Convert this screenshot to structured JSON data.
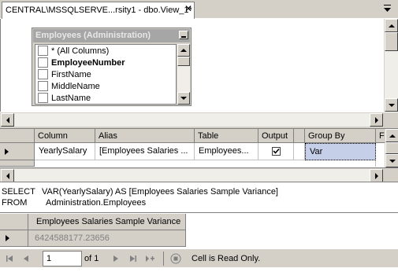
{
  "tab": {
    "title": "CENTRAL\\MSSQLSERVE...rsity1 - dbo.View_1*",
    "close_glyph": "✕"
  },
  "table_box": {
    "title": "Employees (Administration)",
    "columns": [
      {
        "label": "* (All Columns)",
        "bold": false,
        "checked": false
      },
      {
        "label": "EmployeeNumber",
        "bold": true,
        "checked": false
      },
      {
        "label": "FirstName",
        "bold": false,
        "checked": false
      },
      {
        "label": "MiddleName",
        "bold": false,
        "checked": false
      },
      {
        "label": "LastName",
        "bold": false,
        "checked": false
      }
    ]
  },
  "criteria_grid": {
    "headers": {
      "column": "Column",
      "alias": "Alias",
      "table": "Table",
      "output": "Output",
      "group_by": "Group By",
      "filter": "F"
    },
    "row": {
      "column": "YearlySalary",
      "alias": "[Employees Salaries ...",
      "table": "Employees...",
      "output_checked": true,
      "group_by": "Var"
    }
  },
  "sql": {
    "line1_kw": "SELECT",
    "line1_text": "VAR(YearlySalary) AS [Employees Salaries Sample Variance]",
    "line2_kw": "FROM",
    "line2_text": "Administration.Employees"
  },
  "results": {
    "header": "Employees Salaries Sample Variance",
    "value": "6424588177.23656"
  },
  "navigator": {
    "current_page": "1",
    "of_text": "of 1",
    "status": "Cell is Read Only."
  },
  "colors": {
    "selection": "#c6cfe8",
    "chrome": "#d4d0c8",
    "disabled_text": "#808080"
  }
}
